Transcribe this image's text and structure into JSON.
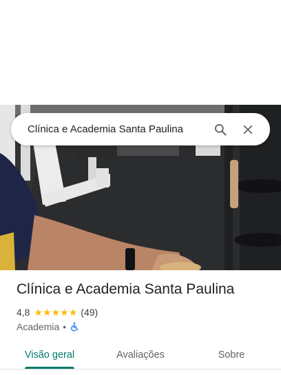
{
  "search": {
    "query": "Clínica e Academia Santa Paulina"
  },
  "place": {
    "name": "Clínica e Academia Santa Paulina",
    "rating": "4,8",
    "stars": 5,
    "review_count": "(49)",
    "category": "Academia",
    "separator": "•"
  },
  "tabs": [
    {
      "label": "Visão geral",
      "active": true
    },
    {
      "label": "Avaliações",
      "active": false
    },
    {
      "label": "Sobre",
      "active": false
    }
  ],
  "colors": {
    "accent": "#00796b",
    "star": "#fbbc04",
    "accessibility": "#1a73e8"
  },
  "icons": {
    "search": "search-icon",
    "close": "close-icon",
    "accessibility": "wheelchair-icon"
  }
}
